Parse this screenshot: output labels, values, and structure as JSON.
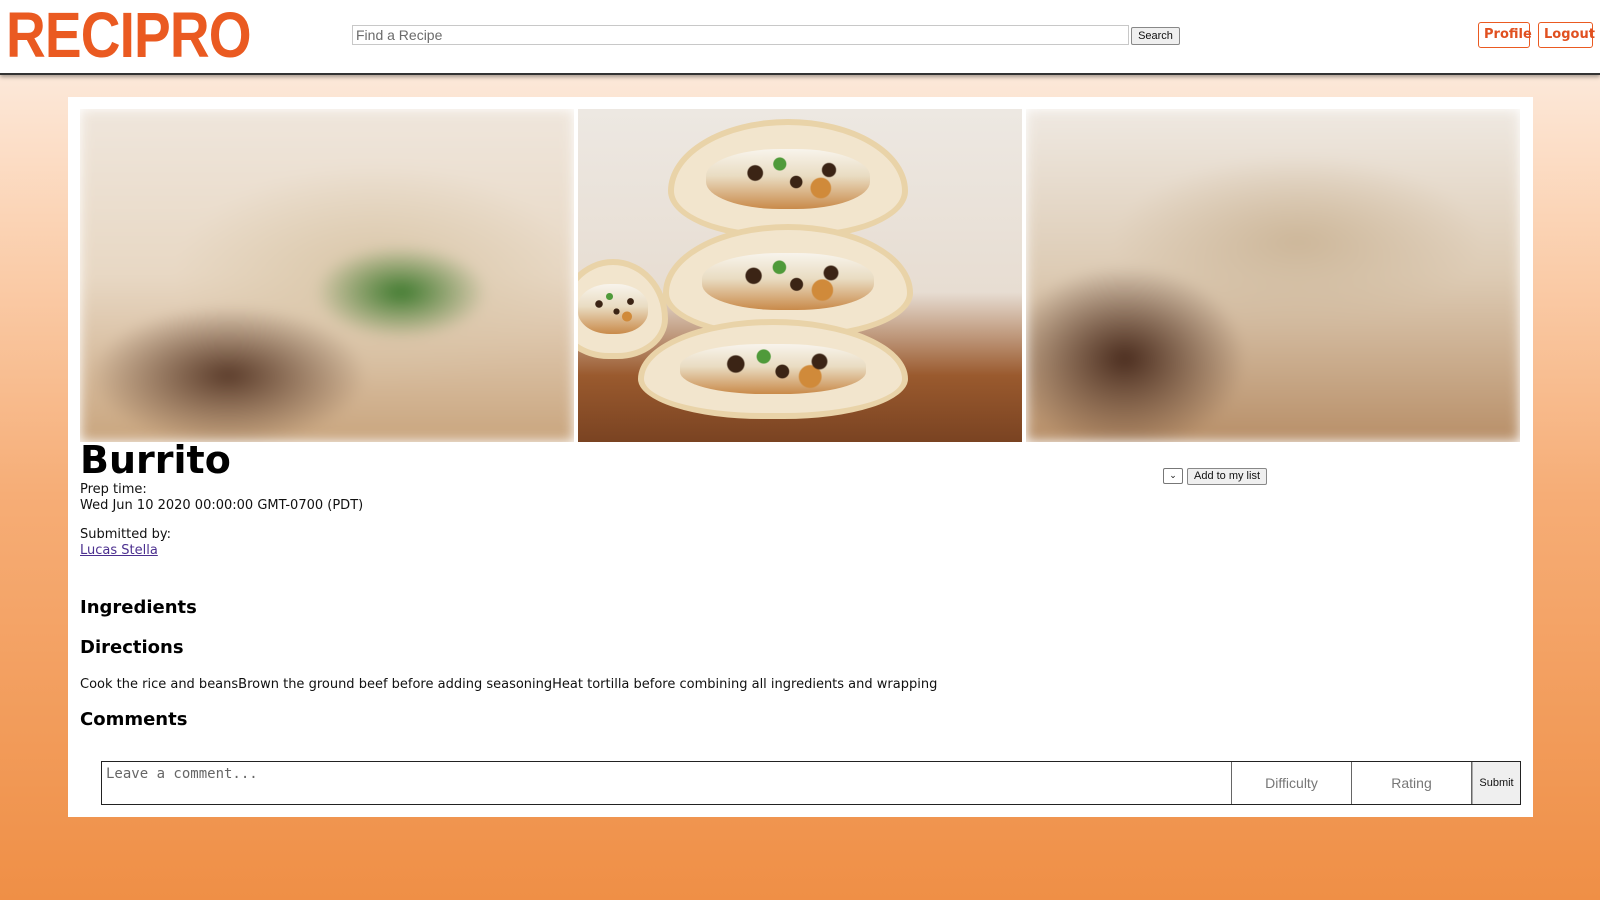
{
  "app": {
    "logo_text": "RECIPRO",
    "brand_color": "#ea5a21"
  },
  "header": {
    "search_placeholder": "Find a Recipe",
    "search_button": "Search",
    "profile_button": "Profile",
    "logout_button": "Logout"
  },
  "recipe": {
    "title": "Burrito",
    "prep_time_label": "Prep time:",
    "prep_time_value": "Wed Jun 10 2020 00:00:00 GMT-0700 (PDT)",
    "submitted_by_label": "Submitted by:",
    "submitted_by_name": "Lucas Stella",
    "list_select_value": "⌄",
    "add_to_list_button": "Add to my list",
    "ingredients_heading": "Ingredients",
    "directions_heading": "Directions",
    "directions_text": "Cook the rice and beansBrown the ground beef before adding seasoningHeat tortilla before combining all ingredients and wrapping",
    "comments_heading": "Comments"
  },
  "comment_form": {
    "comment_placeholder": "Leave a comment...",
    "difficulty_placeholder": "Difficulty",
    "rating_placeholder": "Rating",
    "submit_button": "Submit"
  }
}
